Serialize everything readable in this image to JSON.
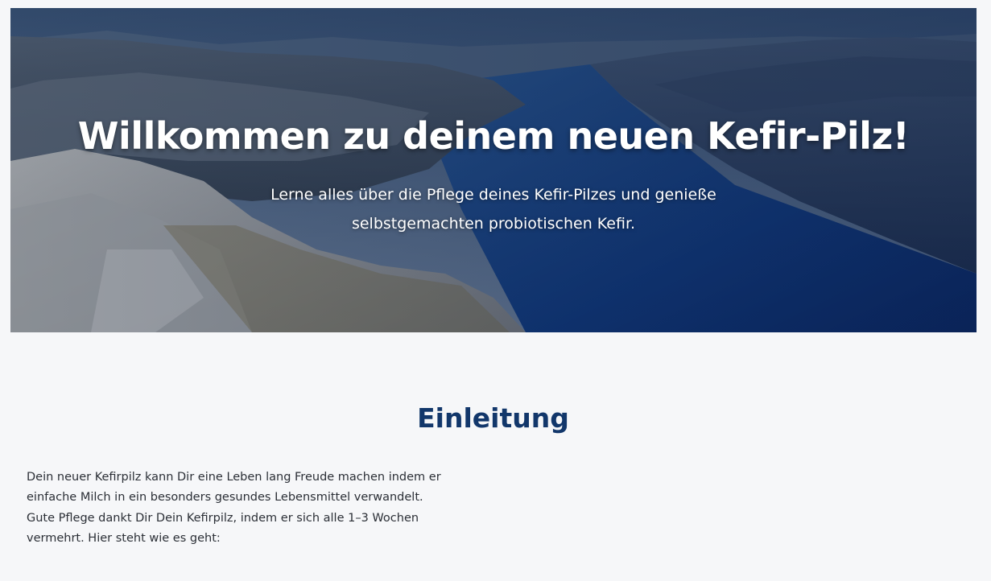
{
  "hero": {
    "title": "Willkommen zu deinem neuen Kefir-Pilz!",
    "subtitle": "Lerne alles über die Pflege deines Kefir-Pilzes und genieße selbstgemachten probiotischen Kefir.",
    "background_image": "fjord-landscape"
  },
  "intro": {
    "heading": "Einleitung",
    "text": "Dein neuer Kefirpilz kann Dir eine Leben lang Freude machen indem er einfache Milch in ein besonders gesundes Lebensmittel verwandelt. Gute Pflege dankt Dir Dein Kefirpilz, indem er sich alle 1–3 Wochen vermehrt. Hier steht wie es geht:"
  },
  "colors": {
    "page_background": "#f6f7f9",
    "heading": "#12376b",
    "body_text": "#2b2f36",
    "hero_text": "#ffffff"
  }
}
